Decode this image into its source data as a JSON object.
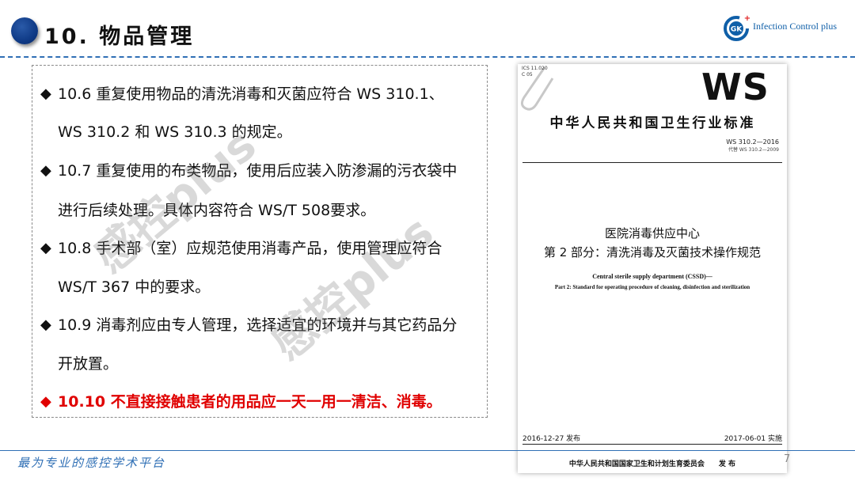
{
  "header": {
    "title": "10. 物品管理",
    "logo_text": "Infection Control plus",
    "logo_mark": "GK"
  },
  "content": {
    "bullets": [
      {
        "line1": "10.6 重复使用物品的清洗消毒和灭菌应符合 WS 310.1、",
        "line2": "WS 310.2 和 WS 310.3 的规定。"
      },
      {
        "line1": "10.7 重复使用的布类物品，使用后应装入防渗漏的污衣袋中",
        "line2": "进行后续处理。具体内容符合 WS/T 508要求。"
      },
      {
        "line1": "10.8 手术部（室）应规范使用消毒产品，使用管理应符合",
        "line2": "WS/T 367 中的要求。"
      },
      {
        "line1": "10.9 消毒剂应由专人管理，选择适宜的环境并与其它药品分",
        "line2": "开放置。"
      },
      {
        "line1": "10.10 不直接接触患者的用品应一天一用一清洁、消毒。"
      }
    ],
    "bullet_symbol": "◆",
    "highlight_color": "#e00000"
  },
  "document": {
    "ics": "ICS 11.020",
    "ccs": "C 05",
    "ws_logo": "WS",
    "standard_title": "中华人民共和国卫生行业标准",
    "standard_no": "WS 310.2—2016",
    "replaces": "代替 WS 310.2—2009",
    "title_cn_1": "医院消毒供应中心",
    "title_cn_2": "第 2 部分：清洗消毒及灭菌技术操作规范",
    "title_en_1": "Central sterile supply department (CSSD)—",
    "title_en_2": "Part 2: Standard for operating procedure of cleaning, disinfection and sterilization",
    "issue_date": "2016-12-27 发布",
    "implement_date": "2017-06-01 实施",
    "publisher": "中华人民共和国国家卫生和计划生育委员会　　发 布"
  },
  "watermark": "感控plus",
  "footer": {
    "slogan": "最为专业的感控学术平台",
    "page_number": "7"
  },
  "colors": {
    "accent_blue": "#2f6fb5",
    "header_circle": "#0f3a86",
    "highlight_red": "#e00000"
  }
}
